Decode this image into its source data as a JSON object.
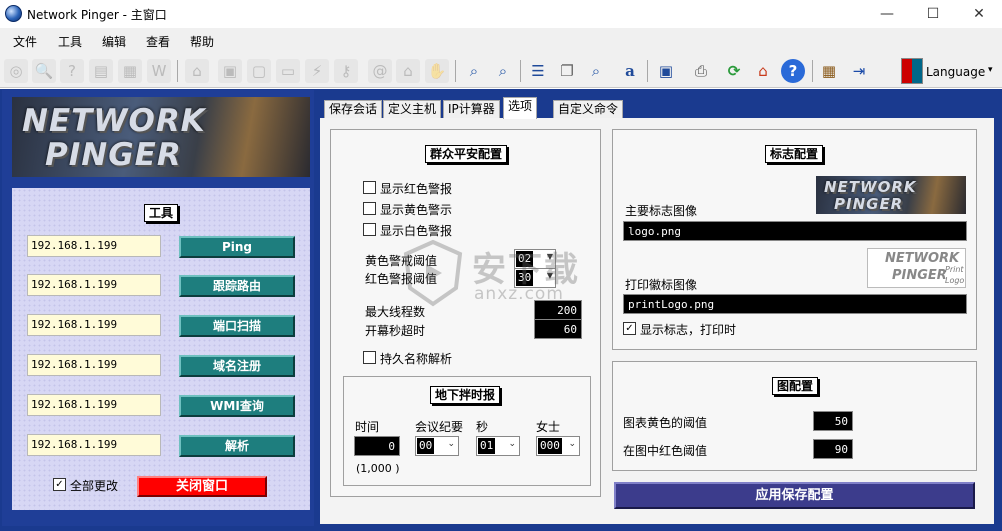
{
  "window": {
    "title": "Network Pinger - 主窗口",
    "minimize": "—",
    "maximize": "☐",
    "close": "✕"
  },
  "menu": [
    "文件",
    "工具",
    "编辑",
    "查看",
    "帮助"
  ],
  "toolbar": {
    "icons": [
      "target-icon",
      "globe-search-icon",
      "whois-icon",
      "document-icon",
      "grid-icon",
      "wmi-icon",
      "network-icon",
      "computer-icon",
      "monitor-icon",
      "plug-icon",
      "key-icon",
      "at-sign-icon",
      "bank-icon",
      "hand-icon",
      "magnifier-up-icon",
      "magnifier-down-icon",
      "stack-icon",
      "copy-icon",
      "find-icon",
      "font-icon",
      "save-icon",
      "print-icon",
      "refresh-icon",
      "home-icon",
      "help-icon",
      "keyboard-icon",
      "exit-icon"
    ],
    "language": "Language"
  },
  "logo": {
    "line1": "NETWORK",
    "line2": "PINGER"
  },
  "tools": {
    "title": "工具",
    "rows": [
      {
        "ip": "192.168.1.199",
        "button": "Ping"
      },
      {
        "ip": "192.168.1.199",
        "button": "跟踪路由"
      },
      {
        "ip": "192.168.1.199",
        "button": "端口扫描"
      },
      {
        "ip": "192.168.1.199",
        "button": "域名注册"
      },
      {
        "ip": "192.168.1.199",
        "button": "WMI查询"
      },
      {
        "ip": "192.168.1.199",
        "button": "解析"
      }
    ],
    "all_changes": "全部更改",
    "close_window": "关闭窗口"
  },
  "tabs": [
    "保存会话",
    "定义主机",
    "IP计算器",
    "选项",
    "自定义命令"
  ],
  "alerts": {
    "title": "群众平安配置",
    "show_red": "显示红色警报",
    "show_yellow": "显示黄色警示",
    "show_white": "显示白色警报",
    "yellow_threshold_label": "黄色警戒阈值",
    "yellow_threshold": "02",
    "red_threshold_label": "红色警报阈值",
    "red_threshold": "30",
    "max_threads_label": "最大线程数",
    "max_threads": "200",
    "timeout_label": "开幕秒超时",
    "timeout": "60",
    "persist_label": "持久名称解析"
  },
  "timer": {
    "title": "地下拌时报",
    "time_label": "时间",
    "time_value": "0",
    "meeting_label": "会议纪要",
    "meeting_value": "00",
    "seconds_label": "秒",
    "seconds_value": "01",
    "lady_label": "女士",
    "lady_value": "000",
    "hint": "(1,000 )"
  },
  "logo_config": {
    "title": "标志配置",
    "main_label": "主要标志图像",
    "main_file": "logo.png",
    "print_label": "打印徽标图像",
    "print_file": "printLogo.png",
    "show_print_label": "显示标志，打印时",
    "preview_line1": "NETWORK",
    "preview_line2": "PINGER",
    "print_preview_line1": "NETWORK",
    "print_preview_line2": "PINGER",
    "print_word": "Print",
    "logo_word": "Logo"
  },
  "chart_config": {
    "title": "图配置",
    "yellow_label": "图表黄色的阈值",
    "yellow_value": "50",
    "red_label": "在图中红色阈值",
    "red_value": "90"
  },
  "apply": "应用保存配置",
  "watermark": {
    "cn": "安下载",
    "en": "anxz.com"
  }
}
